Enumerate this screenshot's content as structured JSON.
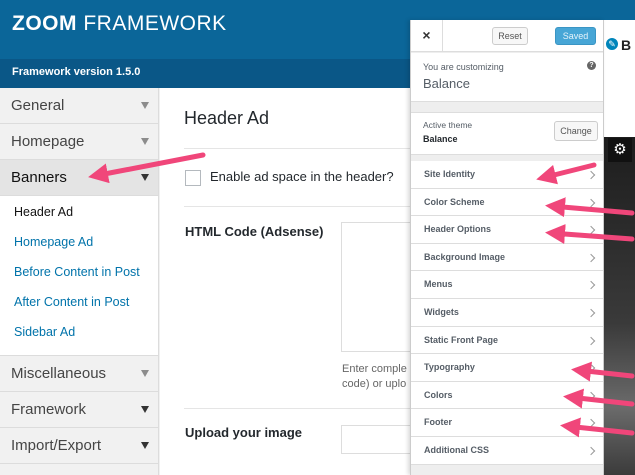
{
  "header": {
    "logo_bold": "ZOOM",
    "logo_rest": " FRAMEWORK",
    "version": "Framework version 1.5.0"
  },
  "sidebar": {
    "items": [
      {
        "label": "General"
      },
      {
        "label": "Homepage"
      },
      {
        "label": "Banners"
      },
      {
        "label": "Miscellaneous"
      },
      {
        "label": "Framework"
      },
      {
        "label": "Import/Export"
      }
    ],
    "banners_sub": [
      {
        "label": "Header Ad"
      },
      {
        "label": "Homepage Ad"
      },
      {
        "label": "Before Content in Post"
      },
      {
        "label": "After Content in Post"
      },
      {
        "label": "Sidebar Ad"
      }
    ]
  },
  "main": {
    "title": "Header Ad",
    "enable_label": "Enable ad space in the header?",
    "html_code_label": "HTML Code (Adsense)",
    "help_line1": "Enter comple",
    "help_line2": "code) or uplo",
    "upload_label": "Upload your image"
  },
  "customizer": {
    "close": "×",
    "reset": "Reset",
    "saved": "Saved",
    "customizing_label": "You are customizing",
    "customizing_name": "Balance",
    "help": "?",
    "active_theme_label": "Active theme",
    "active_theme_name": "Balance",
    "change": "Change",
    "sections": [
      {
        "label": "Site Identity"
      },
      {
        "label": "Color Scheme"
      },
      {
        "label": "Header Options"
      },
      {
        "label": "Background Image"
      },
      {
        "label": "Menus"
      },
      {
        "label": "Widgets"
      },
      {
        "label": "Static Front Page"
      },
      {
        "label": "Typography"
      },
      {
        "label": "Colors"
      },
      {
        "label": "Footer"
      },
      {
        "label": "Additional CSS"
      }
    ]
  },
  "preview": {
    "letter": "B",
    "gear_icon": "gear-icon",
    "edit_icon": "pencil-icon"
  },
  "colors": {
    "header_blue": "#0b6699",
    "version_bar": "#0a5787",
    "link_blue": "#0073aa",
    "arrow_pink": "#f0467a",
    "saved_button": "#47a6d6"
  }
}
